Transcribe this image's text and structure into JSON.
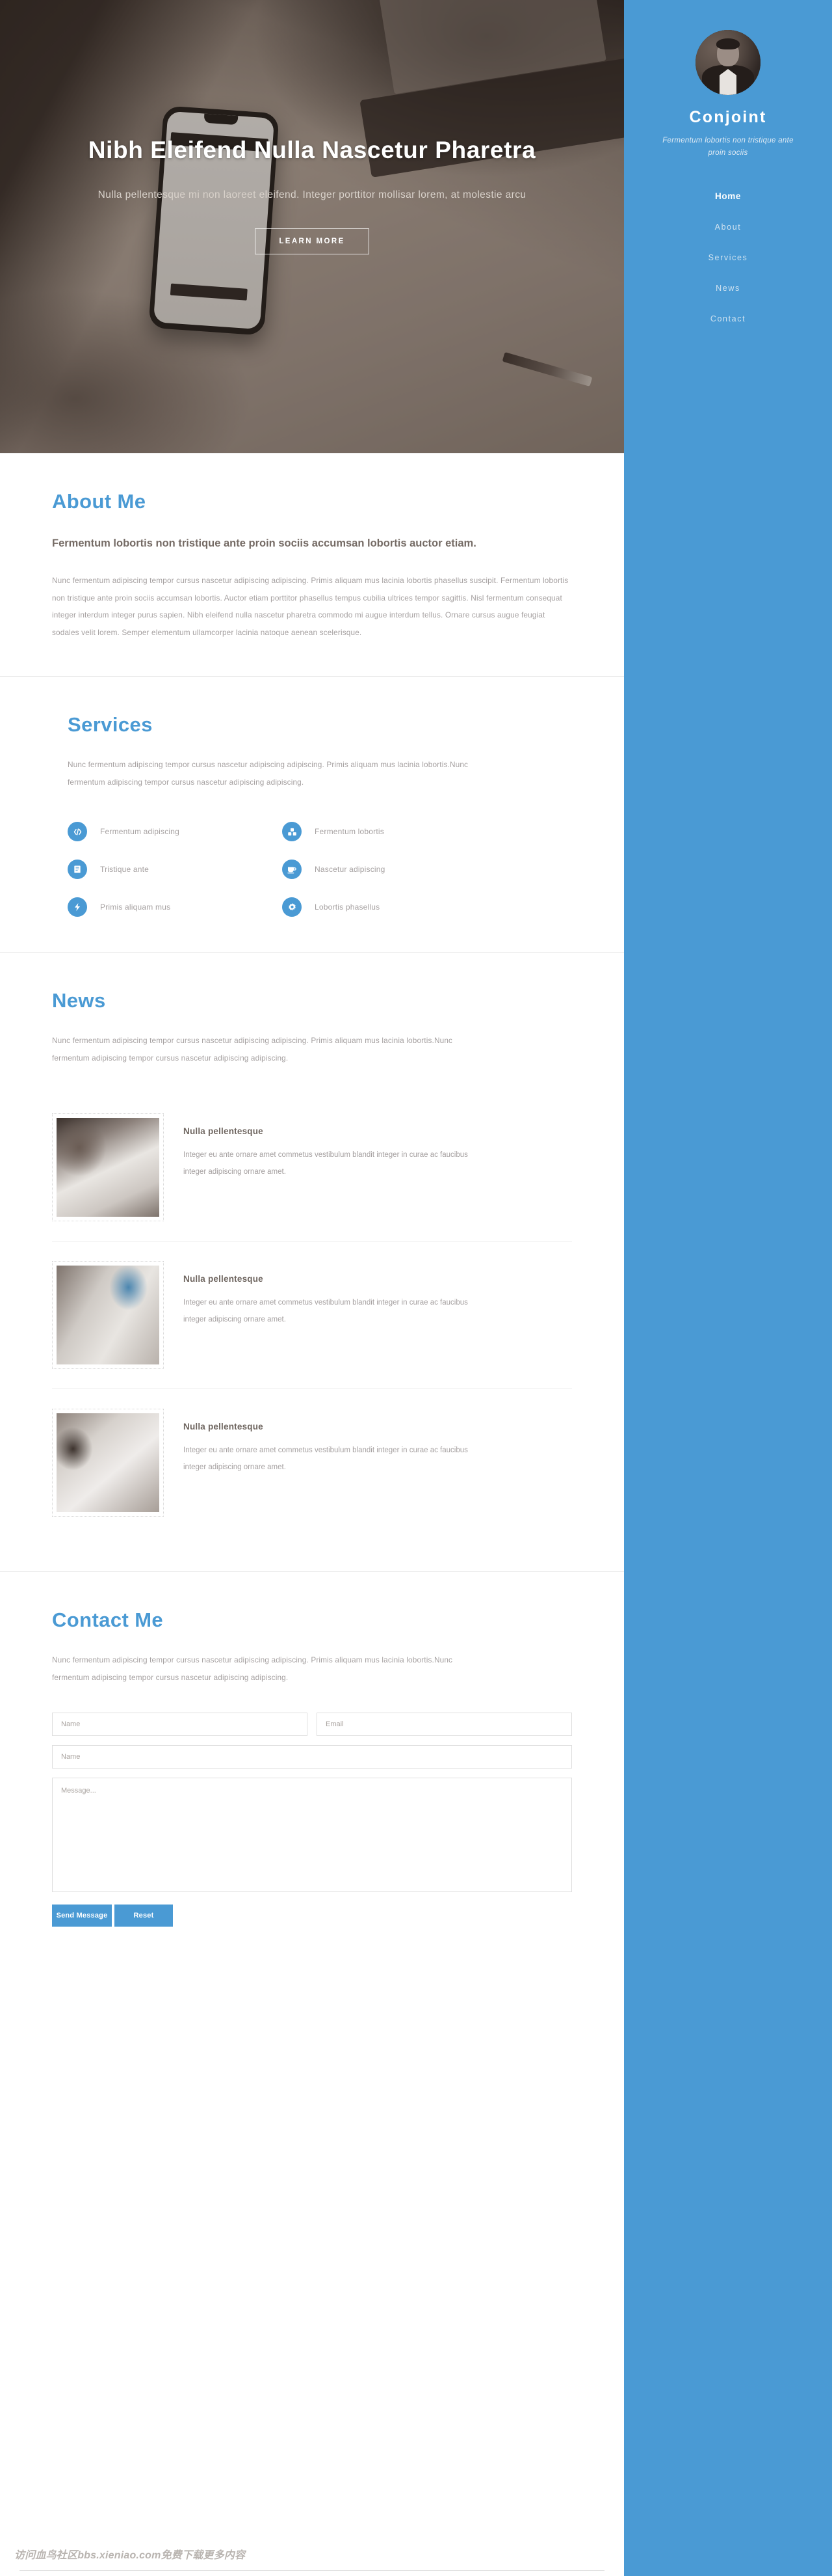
{
  "sidebar": {
    "avatar_alt": "profile-photo",
    "brand": "Conjoint",
    "tagline": "Fermentum lobortis non tristique ante proin sociis",
    "nav": [
      {
        "label": "Home",
        "active": true
      },
      {
        "label": "About",
        "active": false
      },
      {
        "label": "Services",
        "active": false
      },
      {
        "label": "News",
        "active": false
      },
      {
        "label": "Contact",
        "active": false
      }
    ]
  },
  "hero": {
    "title": "Nibh Eleifend Nulla Nascetur Pharetra",
    "subtitle": "Nulla pellentesque mi non laoreet eleifend. Integer porttitor mollisar lorem, at molestie arcu",
    "button": "LEARN MORE"
  },
  "about": {
    "title": "About Me",
    "subtitle": "Fermentum lobortis non tristique ante proin sociis accumsan lobortis auctor etiam.",
    "body": "Nunc fermentum adipiscing tempor cursus nascetur adipiscing adipiscing. Primis aliquam mus lacinia lobortis phasellus suscipit. Fermentum lobortis non tristique ante proin sociis accumsan lobortis. Auctor etiam porttitor phasellus tempus cubilia ultrices tempor sagittis. Nisl fermentum consequat integer interdum integer purus sapien. Nibh eleifend nulla nascetur pharetra commodo mi augue interdum tellus. Ornare cursus augue feugiat sodales velit lorem. Semper elementum ullamcorper lacinia natoque aenean scelerisque."
  },
  "services": {
    "title": "Services",
    "body": "Nunc fermentum adipiscing tempor cursus nascetur adipiscing adipiscing. Primis aliquam mus lacinia lobortis.Nunc fermentum adipiscing tempor cursus nascetur adipiscing adipiscing.",
    "items": [
      {
        "label": "Fermentum adipiscing",
        "icon": "code-icon"
      },
      {
        "label": "Fermentum lobortis",
        "icon": "cubes-icon"
      },
      {
        "label": "Tristique ante",
        "icon": "notebook-icon"
      },
      {
        "label": "Nascetur adipiscing",
        "icon": "coffee-cup-icon"
      },
      {
        "label": "Primis aliquam mus",
        "icon": "bolt-icon"
      },
      {
        "label": "Lobortis phasellus",
        "icon": "gear-icon"
      }
    ]
  },
  "news": {
    "title": "News",
    "body": "Nunc fermentum adipiscing tempor cursus nascetur adipiscing adipiscing. Primis aliquam mus lacinia lobortis.Nunc fermentum adipiscing tempor cursus nascetur adipiscing adipiscing.",
    "items": [
      {
        "title": "Nulla pellentesque",
        "desc": "Integer eu ante ornare amet commetus vestibulum blandit integer in curae ac faucibus integer adipiscing ornare amet.",
        "thumb": "meeting-photo"
      },
      {
        "title": "Nulla pellentesque",
        "desc": "Integer eu ante ornare amet commetus vestibulum blandit integer in curae ac faucibus integer adipiscing ornare amet.",
        "thumb": "dont-look-back-poster-photo"
      },
      {
        "title": "Nulla pellentesque",
        "desc": "Integer eu ante ornare amet commetus vestibulum blandit integer in curae ac faucibus integer adipiscing ornare amet.",
        "thumb": "desk-writing-photo"
      }
    ]
  },
  "contact": {
    "title": "Contact Me",
    "body": "Nunc fermentum adipiscing tempor cursus nascetur adipiscing adipiscing. Primis aliquam mus lacinia lobortis.Nunc fermentum adipiscing tempor cursus nascetur adipiscing adipiscing.",
    "form": {
      "name_placeholder": "Name",
      "email_placeholder": "Email",
      "subject_placeholder": "Name",
      "message_placeholder": "Message...",
      "name_value": "",
      "email_value": "",
      "subject_value": "",
      "message_value": "",
      "submit_label": "Send Message",
      "reset_label": "Reset"
    }
  },
  "watermark": "访问血鸟社区bbs.xieniao.com免费下载更多内容",
  "colors": {
    "accent": "#4a9ad4",
    "heading": "#756b65",
    "body_text": "#a5a0a0",
    "hero_text": "#ffffff"
  }
}
